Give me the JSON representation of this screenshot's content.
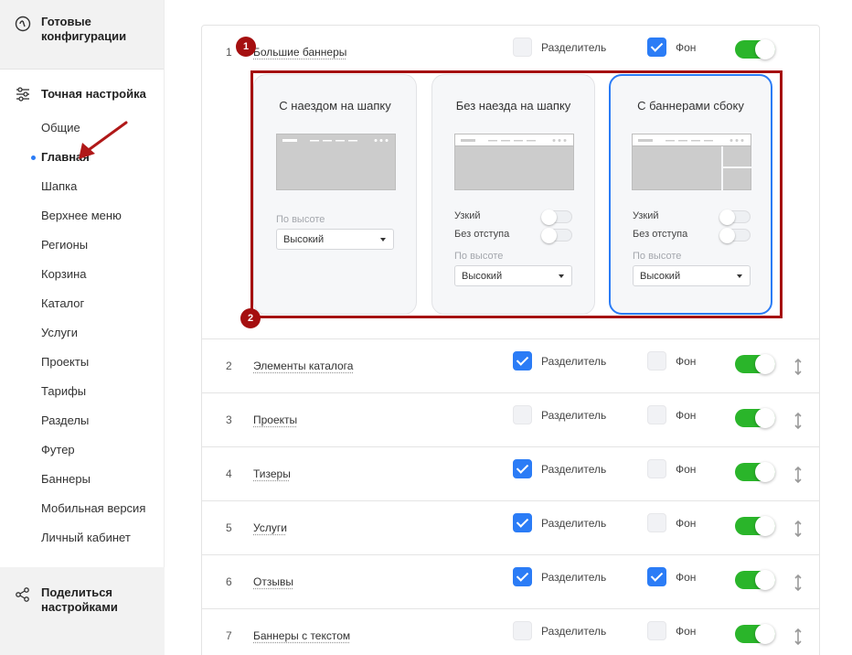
{
  "sidebar": {
    "ready_configs": [
      "Готовые",
      "конфигурации"
    ],
    "fine_tuning": "Точная настройка",
    "items": [
      {
        "label": "Общие",
        "active": false
      },
      {
        "label": "Главная",
        "active": true
      },
      {
        "label": "Шапка",
        "active": false
      },
      {
        "label": "Верхнее меню",
        "active": false
      },
      {
        "label": "Регионы",
        "active": false
      },
      {
        "label": "Корзина",
        "active": false
      },
      {
        "label": "Каталог",
        "active": false
      },
      {
        "label": "Услуги",
        "active": false
      },
      {
        "label": "Проекты",
        "active": false
      },
      {
        "label": "Тарифы",
        "active": false
      },
      {
        "label": "Разделы",
        "active": false
      },
      {
        "label": "Футер",
        "active": false
      },
      {
        "label": "Баннеры",
        "active": false
      },
      {
        "label": "Мобильная версия",
        "active": false
      },
      {
        "label": "Личный кабинет",
        "active": false
      }
    ],
    "share": [
      "Поделиться",
      "настройками"
    ]
  },
  "labels": {
    "divider": "Разделитель",
    "background": "Фон"
  },
  "first_row": {
    "number": "1",
    "name": "Большие баннеры",
    "divider_checked": false,
    "background_checked": true,
    "enabled": true
  },
  "variants": [
    {
      "title": "С наездом на шапку",
      "selected": false,
      "height_label": "По высоте",
      "height_value": "Высокий"
    },
    {
      "title": "Без наезда на шапку",
      "selected": false,
      "narrow": "Узкий",
      "no_margin": "Без отступа",
      "height_label": "По высоте",
      "height_value": "Высокий"
    },
    {
      "title": "С баннерами сбоку",
      "selected": true,
      "narrow": "Узкий",
      "no_margin": "Без отступа",
      "height_label": "По высоте",
      "height_value": "Высокий"
    }
  ],
  "annotations": [
    "1",
    "2"
  ],
  "rows": [
    {
      "number": "2",
      "name": "Элементы каталога",
      "divider_checked": true,
      "background_checked": false,
      "enabled": true
    },
    {
      "number": "3",
      "name": "Проекты",
      "divider_checked": false,
      "background_checked": false,
      "enabled": true
    },
    {
      "number": "4",
      "name": "Тизеры",
      "divider_checked": true,
      "background_checked": false,
      "enabled": true
    },
    {
      "number": "5",
      "name": "Услуги",
      "divider_checked": true,
      "background_checked": false,
      "enabled": true
    },
    {
      "number": "6",
      "name": "Отзывы",
      "divider_checked": true,
      "background_checked": true,
      "enabled": true
    },
    {
      "number": "7",
      "name": "Баннеры с текстом",
      "divider_checked": false,
      "background_checked": false,
      "enabled": true
    }
  ],
  "colors": {
    "accent": "#2b7cf6",
    "toggle_on": "#2ab52a",
    "annotation": "#a50f10"
  }
}
